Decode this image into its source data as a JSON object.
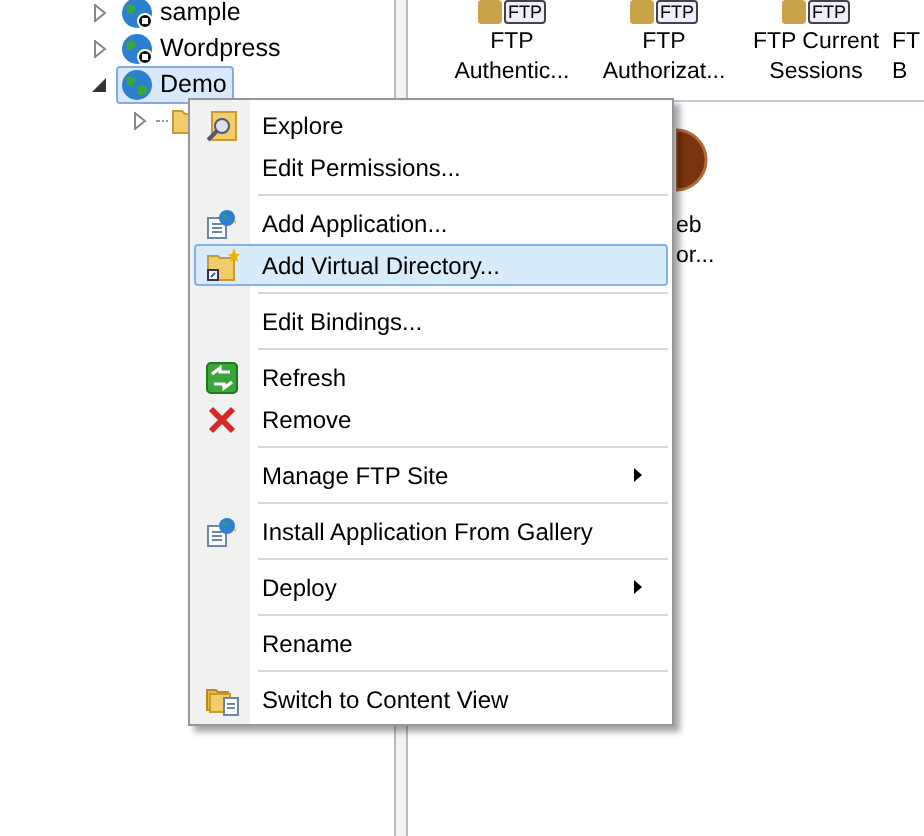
{
  "tree": [
    {
      "label": "sample",
      "expanded": false,
      "selected": false
    },
    {
      "label": "Wordpress",
      "expanded": false,
      "selected": false
    },
    {
      "label": "Demo",
      "expanded": true,
      "selected": true,
      "children": [
        {
          "expanded": false,
          "selected": false
        }
      ]
    }
  ],
  "features": [
    {
      "badge": "FTP",
      "lines": [
        "FTP",
        "Authentic..."
      ]
    },
    {
      "badge": "FTP",
      "lines": [
        "FTP",
        "Authorizat..."
      ]
    },
    {
      "badge": "FTP",
      "lines": [
        "FTP Current",
        "Sessions"
      ]
    },
    {
      "lines": [
        "FT",
        "B"
      ]
    }
  ],
  "features_row_2": [
    {
      "lines": [
        "eb",
        "or..."
      ]
    }
  ],
  "context_menu": [
    {
      "kind": "item",
      "label": "Explore",
      "submenu": false,
      "selected": false
    },
    {
      "kind": "item",
      "label": "Edit Permissions...",
      "submenu": false,
      "selected": false
    },
    {
      "kind": "separator"
    },
    {
      "kind": "item",
      "label": "Add Application...",
      "submenu": false,
      "selected": false
    },
    {
      "kind": "item",
      "label": "Add Virtual Directory...",
      "submenu": false,
      "selected": true
    },
    {
      "kind": "separator"
    },
    {
      "kind": "item",
      "label": "Edit Bindings...",
      "submenu": false,
      "selected": false
    },
    {
      "kind": "separator"
    },
    {
      "kind": "item",
      "label": "Refresh",
      "submenu": false,
      "selected": false
    },
    {
      "kind": "item",
      "label": "Remove",
      "submenu": false,
      "selected": false
    },
    {
      "kind": "separator"
    },
    {
      "kind": "item",
      "label": "Manage FTP Site",
      "submenu": true,
      "selected": false
    },
    {
      "kind": "separator"
    },
    {
      "kind": "item",
      "label": "Install Application From Gallery",
      "submenu": false,
      "selected": false
    },
    {
      "kind": "separator"
    },
    {
      "kind": "item",
      "label": "Deploy",
      "submenu": true,
      "selected": false
    },
    {
      "kind": "separator"
    },
    {
      "kind": "item",
      "label": "Rename",
      "submenu": false,
      "selected": false
    },
    {
      "kind": "separator"
    },
    {
      "kind": "item",
      "label": "Switch to Content View",
      "submenu": false,
      "selected": false
    }
  ]
}
